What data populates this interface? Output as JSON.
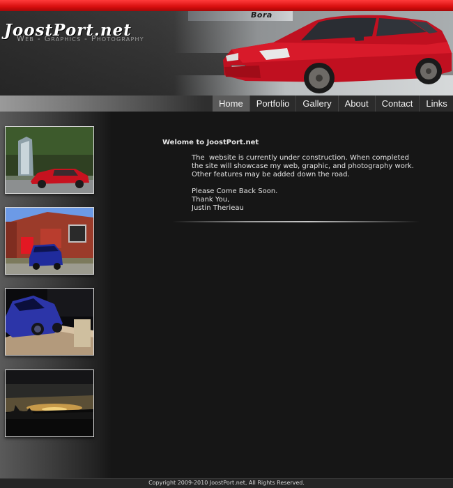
{
  "brand": {
    "logo": "JoostPort.net",
    "tagline": "Web - Graphics - Photography",
    "sign_text": "Bora"
  },
  "nav": {
    "items": [
      "Home",
      "Portfolio",
      "Gallery",
      "About",
      "Contact",
      "Links"
    ],
    "active": "Home"
  },
  "main": {
    "title": "Welome to JoostPort.net",
    "lines": [
      "The  website is currently under construction. When completed",
      "the site will showcase my web, graphic, and photography work.",
      "Other features may be added down the road.",
      "Please Come Back Soon.",
      "Thank You,",
      "Justin Therieau"
    ]
  },
  "thumbnails": [
    {
      "name": "thumb-red-car-waterfall"
    },
    {
      "name": "thumb-blue-car-building"
    },
    {
      "name": "thumb-blue-car-night"
    },
    {
      "name": "thumb-sunset"
    }
  ],
  "footer": {
    "copyright": "Copyright 2009-2010 JoostPort.net, All Rights Reserved."
  },
  "colors": {
    "accent_stripe": "#e01414",
    "background": "#161616",
    "nav_active": "#5a5a5a"
  }
}
